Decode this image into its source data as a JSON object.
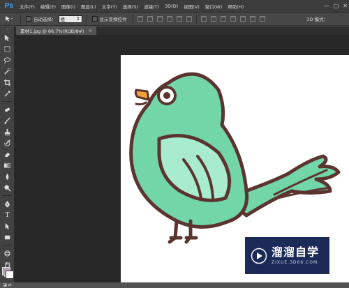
{
  "app": {
    "logo": "Ps"
  },
  "menu": [
    "文件(F)",
    "编辑(E)",
    "图像(I)",
    "图层(L)",
    "文字(Y)",
    "选择(S)",
    "滤镜(T)",
    "3D(D)",
    "视图(V)",
    "窗口(W)",
    "帮助(H)"
  ],
  "window_controls": {
    "minimize": "—",
    "maximize": "□",
    "close": "✕"
  },
  "options": {
    "auto_select_label": "自动选择：",
    "auto_select_value": "组",
    "show_transform_label": "显示变换控件",
    "mode_3d_label": "3D 模式："
  },
  "document": {
    "tab_title": "素材1.jpg @ 66.7%(RGB/8#)",
    "close": "×"
  },
  "colors": {
    "foreground": "#b7a0b6",
    "background": "#ffffff",
    "bird_body": "#72d6a9",
    "bird_wing": "#a8ebcf",
    "outline": "#5b3430",
    "beak": "#f4a23a"
  },
  "watermark": {
    "title": "溜溜自学",
    "url": "ZIXUE.3D66.COM"
  }
}
